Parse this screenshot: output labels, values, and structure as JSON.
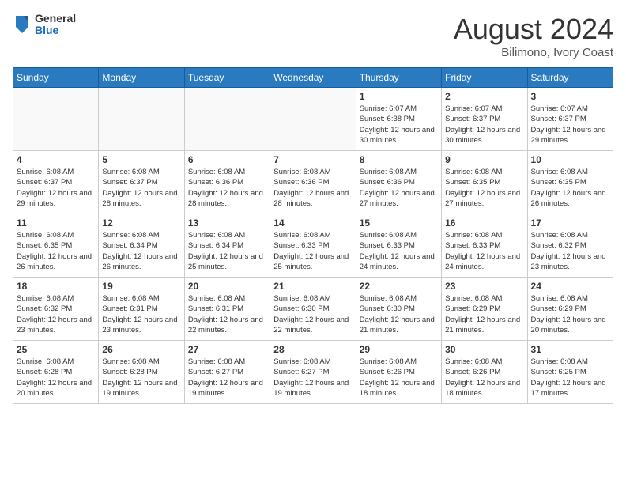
{
  "header": {
    "logo": {
      "general": "General",
      "blue": "Blue"
    },
    "title": "August 2024",
    "location": "Bilimono, Ivory Coast"
  },
  "calendar": {
    "days_of_week": [
      "Sunday",
      "Monday",
      "Tuesday",
      "Wednesday",
      "Thursday",
      "Friday",
      "Saturday"
    ],
    "weeks": [
      [
        {
          "day": "",
          "empty": true
        },
        {
          "day": "",
          "empty": true
        },
        {
          "day": "",
          "empty": true
        },
        {
          "day": "",
          "empty": true
        },
        {
          "day": "1",
          "sunrise": "6:07 AM",
          "sunset": "6:38 PM",
          "daylight": "12 hours and 30 minutes."
        },
        {
          "day": "2",
          "sunrise": "6:07 AM",
          "sunset": "6:37 PM",
          "daylight": "12 hours and 30 minutes."
        },
        {
          "day": "3",
          "sunrise": "6:07 AM",
          "sunset": "6:37 PM",
          "daylight": "12 hours and 29 minutes."
        }
      ],
      [
        {
          "day": "4",
          "sunrise": "6:08 AM",
          "sunset": "6:37 PM",
          "daylight": "12 hours and 29 minutes."
        },
        {
          "day": "5",
          "sunrise": "6:08 AM",
          "sunset": "6:37 PM",
          "daylight": "12 hours and 28 minutes."
        },
        {
          "day": "6",
          "sunrise": "6:08 AM",
          "sunset": "6:36 PM",
          "daylight": "12 hours and 28 minutes."
        },
        {
          "day": "7",
          "sunrise": "6:08 AM",
          "sunset": "6:36 PM",
          "daylight": "12 hours and 28 minutes."
        },
        {
          "day": "8",
          "sunrise": "6:08 AM",
          "sunset": "6:36 PM",
          "daylight": "12 hours and 27 minutes."
        },
        {
          "day": "9",
          "sunrise": "6:08 AM",
          "sunset": "6:35 PM",
          "daylight": "12 hours and 27 minutes."
        },
        {
          "day": "10",
          "sunrise": "6:08 AM",
          "sunset": "6:35 PM",
          "daylight": "12 hours and 26 minutes."
        }
      ],
      [
        {
          "day": "11",
          "sunrise": "6:08 AM",
          "sunset": "6:35 PM",
          "daylight": "12 hours and 26 minutes."
        },
        {
          "day": "12",
          "sunrise": "6:08 AM",
          "sunset": "6:34 PM",
          "daylight": "12 hours and 26 minutes."
        },
        {
          "day": "13",
          "sunrise": "6:08 AM",
          "sunset": "6:34 PM",
          "daylight": "12 hours and 25 minutes."
        },
        {
          "day": "14",
          "sunrise": "6:08 AM",
          "sunset": "6:33 PM",
          "daylight": "12 hours and 25 minutes."
        },
        {
          "day": "15",
          "sunrise": "6:08 AM",
          "sunset": "6:33 PM",
          "daylight": "12 hours and 24 minutes."
        },
        {
          "day": "16",
          "sunrise": "6:08 AM",
          "sunset": "6:33 PM",
          "daylight": "12 hours and 24 minutes."
        },
        {
          "day": "17",
          "sunrise": "6:08 AM",
          "sunset": "6:32 PM",
          "daylight": "12 hours and 23 minutes."
        }
      ],
      [
        {
          "day": "18",
          "sunrise": "6:08 AM",
          "sunset": "6:32 PM",
          "daylight": "12 hours and 23 minutes."
        },
        {
          "day": "19",
          "sunrise": "6:08 AM",
          "sunset": "6:31 PM",
          "daylight": "12 hours and 23 minutes."
        },
        {
          "day": "20",
          "sunrise": "6:08 AM",
          "sunset": "6:31 PM",
          "daylight": "12 hours and 22 minutes."
        },
        {
          "day": "21",
          "sunrise": "6:08 AM",
          "sunset": "6:30 PM",
          "daylight": "12 hours and 22 minutes."
        },
        {
          "day": "22",
          "sunrise": "6:08 AM",
          "sunset": "6:30 PM",
          "daylight": "12 hours and 21 minutes."
        },
        {
          "day": "23",
          "sunrise": "6:08 AM",
          "sunset": "6:29 PM",
          "daylight": "12 hours and 21 minutes."
        },
        {
          "day": "24",
          "sunrise": "6:08 AM",
          "sunset": "6:29 PM",
          "daylight": "12 hours and 20 minutes."
        }
      ],
      [
        {
          "day": "25",
          "sunrise": "6:08 AM",
          "sunset": "6:28 PM",
          "daylight": "12 hours and 20 minutes."
        },
        {
          "day": "26",
          "sunrise": "6:08 AM",
          "sunset": "6:28 PM",
          "daylight": "12 hours and 19 minutes."
        },
        {
          "day": "27",
          "sunrise": "6:08 AM",
          "sunset": "6:27 PM",
          "daylight": "12 hours and 19 minutes."
        },
        {
          "day": "28",
          "sunrise": "6:08 AM",
          "sunset": "6:27 PM",
          "daylight": "12 hours and 19 minutes."
        },
        {
          "day": "29",
          "sunrise": "6:08 AM",
          "sunset": "6:26 PM",
          "daylight": "12 hours and 18 minutes."
        },
        {
          "day": "30",
          "sunrise": "6:08 AM",
          "sunset": "6:26 PM",
          "daylight": "12 hours and 18 minutes."
        },
        {
          "day": "31",
          "sunrise": "6:08 AM",
          "sunset": "6:25 PM",
          "daylight": "12 hours and 17 minutes."
        }
      ]
    ]
  }
}
